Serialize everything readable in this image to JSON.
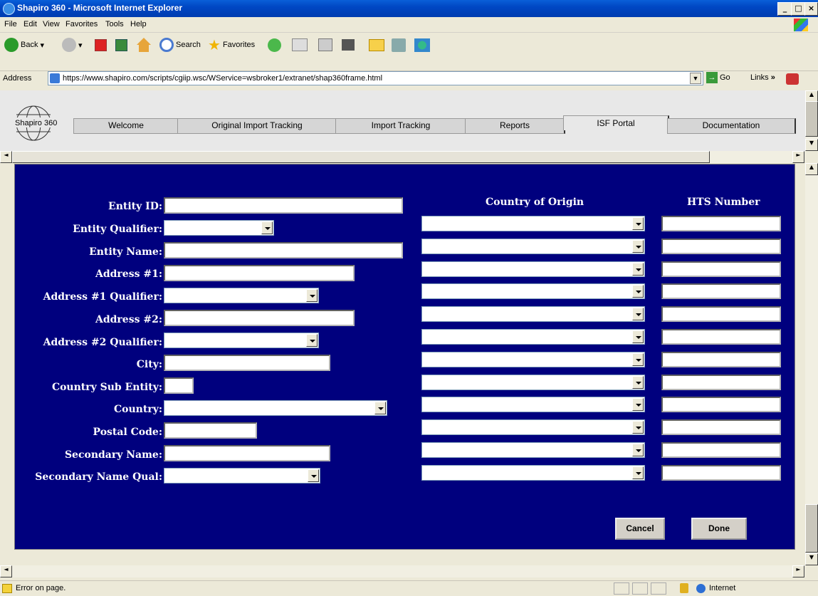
{
  "window": {
    "title": "Shapiro 360 - Microsoft Internet Explorer"
  },
  "menu": {
    "items": [
      "File",
      "Edit",
      "View",
      "Favorites",
      "Tools",
      "Help"
    ]
  },
  "toolbar": {
    "back_label": "Back",
    "search_label": "Search",
    "favorites_label": "Favorites"
  },
  "address": {
    "label": "Address",
    "url": "https://www.shapiro.com/scripts/cgiip.wsc/WService=wsbroker1/extranet/shap360frame.html",
    "go_label": "Go",
    "links_label": "Links"
  },
  "nav": {
    "logo_text": "Shapiro 360",
    "tabs": [
      "Welcome",
      "Original Import Tracking",
      "Import Tracking",
      "Reports",
      "ISF Portal",
      "Documentation"
    ],
    "active_tab": "ISF Portal"
  },
  "form": {
    "labels": {
      "entity_id": "Entity ID:",
      "entity_qualifier": "Entity Qualifier:",
      "entity_name": "Entity Name:",
      "address1": "Address #1:",
      "address1_qualifier": "Address #1 Qualifier:",
      "address2": "Address #2:",
      "address2_qualifier": "Address #2 Qualifier:",
      "city": "City:",
      "country_sub_entity": "Country Sub Entity:",
      "country": "Country:",
      "postal_code": "Postal Code:",
      "secondary_name": "Secondary Name:",
      "secondary_name_qual": "Secondary Name Qual:"
    },
    "values": {
      "entity_id": "",
      "entity_qualifier": "",
      "entity_name": "",
      "address1": "",
      "address1_qualifier": "",
      "address2": "",
      "address2_qualifier": "",
      "city": "",
      "country_sub_entity": "",
      "country": "",
      "postal_code": "",
      "secondary_name": "",
      "secondary_name_qual": ""
    }
  },
  "grid": {
    "country_header": "Country of Origin",
    "hts_header": "HTS Number",
    "rows": 12
  },
  "buttons": {
    "cancel": "Cancel",
    "done": "Done"
  },
  "status": {
    "text": "Error on page.",
    "zone": "Internet"
  }
}
